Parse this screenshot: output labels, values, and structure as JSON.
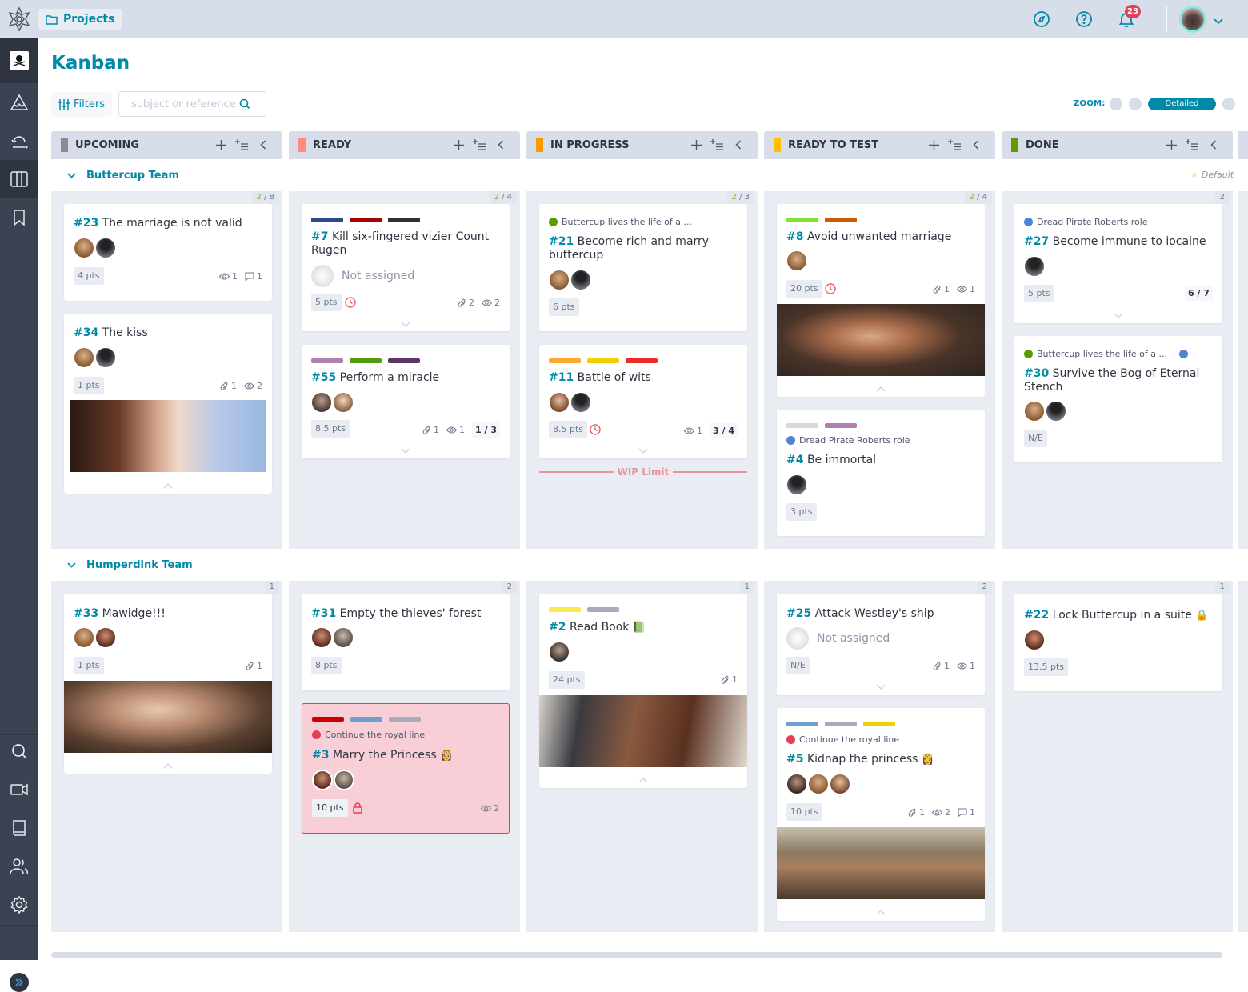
{
  "topbar": {
    "projects_label": "Projects",
    "notifications_count": "23",
    "icons": [
      "compass-icon",
      "help-icon",
      "bell-icon"
    ]
  },
  "sidebar": {
    "items": [
      {
        "name": "project-logo",
        "icon": "jolly-roger-icon"
      },
      {
        "name": "epics",
        "icon": "mountain-icon"
      },
      {
        "name": "sprints",
        "icon": "cycle-icon"
      },
      {
        "name": "kanban",
        "icon": "columns-icon",
        "active": true
      },
      {
        "name": "wiki-bookmarks",
        "icon": "bookmark-icon"
      },
      {
        "name": "search",
        "icon": "search-icon"
      },
      {
        "name": "video",
        "icon": "video-icon"
      },
      {
        "name": "wiki",
        "icon": "book-icon"
      },
      {
        "name": "team",
        "icon": "team-icon"
      },
      {
        "name": "settings",
        "icon": "gear-icon"
      }
    ],
    "expand_label": "»"
  },
  "page": {
    "title": "Kanban",
    "filters_label": "Filters",
    "search_placeholder": "subject or reference",
    "zoom_label": "ZOOM:",
    "zoom_selected": "Detailed"
  },
  "columns": [
    {
      "title": "UPCOMING",
      "color": "#8c8c8c"
    },
    {
      "title": "READY",
      "color": "#ff8a84"
    },
    {
      "title": "IN PROGRESS",
      "color": "#ff9900"
    },
    {
      "title": "READY TO TEST",
      "color": "#fcc000"
    },
    {
      "title": "DONE",
      "color": "#669900"
    }
  ],
  "swimlanes": [
    {
      "title": "Buttercup Team",
      "default_label": "Default",
      "counts": [
        {
          "done": "2",
          "total": "8"
        },
        {
          "done": "2",
          "total": "4"
        },
        {
          "done": "2",
          "total": "3"
        },
        {
          "done": "2",
          "total": "4"
        },
        {
          "total": "2"
        }
      ],
      "wip_limit_label": "WIP Limit"
    },
    {
      "title": "Humperdink Team",
      "counts": [
        {
          "total": "1"
        },
        {
          "total": "2"
        },
        {
          "total": "1"
        },
        {
          "total": "2"
        },
        {
          "total": "1"
        }
      ]
    }
  ],
  "cards": {
    "c23": {
      "ref": "#23",
      "title": "The marriage is not valid",
      "points": "4 pts",
      "watchers": "1",
      "comments": "1"
    },
    "c34": {
      "ref": "#34",
      "title": "The kiss",
      "points": "1 pts",
      "attachments": "1",
      "watchers": "2"
    },
    "c7": {
      "ref": "#7",
      "title": "Kill six-fingered vizier Count Rugen",
      "tags": [
        "#2a4a8a",
        "#a80000",
        "#2e3136"
      ],
      "assigned": "Not assigned",
      "points": "5 pts",
      "attachments": "2",
      "watchers": "2",
      "due": "clock-icon"
    },
    "c55": {
      "ref": "#55",
      "title": "Perform a miracle",
      "tags": [
        "#b07fae",
        "#529b0c",
        "#5b3566"
      ],
      "points": "8.5 pts",
      "attachments": "1",
      "watchers": "1",
      "tasks": "1 / 3"
    },
    "c21": {
      "ref": "#21",
      "epic": "Buttercup lives the life of a ...",
      "epic_color": "#5b9a00",
      "title": "Become rich and marry buttercup",
      "points": "6 pts"
    },
    "c11": {
      "ref": "#11",
      "title": "Battle of wits",
      "tags": [
        "#fbab32",
        "#f0d000",
        "#ee2b2b"
      ],
      "points": "8.5 pts",
      "watchers": "1",
      "tasks": "3 / 4",
      "due": "clock-icon"
    },
    "c8": {
      "ref": "#8",
      "title": "Avoid unwanted marriage",
      "tags": [
        "#84e130",
        "#d05a00"
      ],
      "points": "20 pts",
      "attachments": "1",
      "watchers": "1",
      "due": "clock-icon"
    },
    "c4": {
      "ref": "#4",
      "tags": [
        "#d8dbd2",
        "#b07fae"
      ],
      "epic": "Dread Pirate Roberts role",
      "epic_color": "#4f83d6",
      "title": "Be immortal",
      "points": "3 pts"
    },
    "c27": {
      "ref": "#27",
      "epic": "Dread Pirate Roberts role",
      "epic_color": "#4f83d6",
      "title": "Become immune to iocaine",
      "points": "5 pts",
      "tasks": "6 / 7"
    },
    "c30": {
      "ref": "#30",
      "epic": "Buttercup lives the life of a ...",
      "epic_color": "#5b9a00",
      "epic2_color": "#4f83d6",
      "title": "Survive the Bog of Eternal Stench",
      "points": "N/E"
    },
    "c33": {
      "ref": "#33",
      "title": "Mawidge!!!",
      "points": "1 pts",
      "attachments": "1"
    },
    "c31": {
      "ref": "#31",
      "title": "Empty the thieves' forest",
      "points": "8 pts"
    },
    "c3": {
      "ref": "#3",
      "tags": [
        "#cc0000",
        "#70a0d0",
        "#a9aabc"
      ],
      "epic": "Continue the royal line",
      "epic_color": "#e44057",
      "title": "Marry the Princess",
      "emoji": "👸",
      "points": "10 pts",
      "watchers": "2",
      "blocked": true
    },
    "c2": {
      "ref": "#2",
      "tags": [
        "#fbe94d",
        "#a9aabc"
      ],
      "title": "Read Book",
      "emoji": "📗",
      "points": "24 pts",
      "attachments": "1"
    },
    "c25": {
      "ref": "#25",
      "title": "Attack Westley's ship",
      "assigned": "Not assigned",
      "points": "N/E",
      "attachments": "1",
      "watchers": "1"
    },
    "c5": {
      "ref": "#5",
      "tags": [
        "#70a0d0",
        "#a9aabc",
        "#f0d000"
      ],
      "epic": "Continue the royal line",
      "epic_color": "#e44057",
      "title": "Kidnap the princess",
      "emoji": "👸",
      "points": "10 pts",
      "attachments": "1",
      "watchers": "2",
      "comments": "1"
    },
    "c22": {
      "ref": "#22",
      "title": "Lock Buttercup in a suite",
      "emoji": "🔒",
      "points": "13.5 pts"
    }
  }
}
